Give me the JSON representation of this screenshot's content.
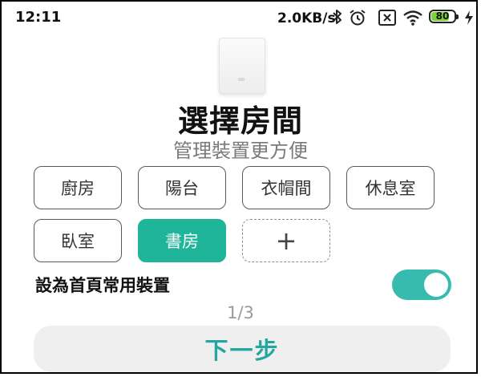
{
  "status_bar": {
    "time": "12:11",
    "network_speed": "2.0KB/s",
    "battery_level": "80",
    "battery_fraction": 0.8,
    "icons": [
      "bluetooth-icon",
      "alarm-icon",
      "sim-icon",
      "wifi-icon",
      "battery-icon",
      "charging-icon"
    ]
  },
  "header": {
    "title": "選擇房間",
    "subtitle": "管理裝置更方便"
  },
  "rooms": [
    {
      "label": "廚房",
      "selected": false
    },
    {
      "label": "陽台",
      "selected": false
    },
    {
      "label": "衣帽間",
      "selected": false
    },
    {
      "label": "休息室",
      "selected": false
    },
    {
      "label": "臥室",
      "selected": false
    },
    {
      "label": "書房",
      "selected": true
    }
  ],
  "add_room": {
    "label": "+"
  },
  "home_device": {
    "label": "設為首頁常用裝置",
    "enabled": true
  },
  "pager": {
    "text": "1/3"
  },
  "next_button": {
    "label": "下一步"
  },
  "colors": {
    "accent": "#1eb59a",
    "toggle": "#36bbae",
    "next_text": "#23a7a0",
    "subtitle": "#7a7a7a"
  }
}
